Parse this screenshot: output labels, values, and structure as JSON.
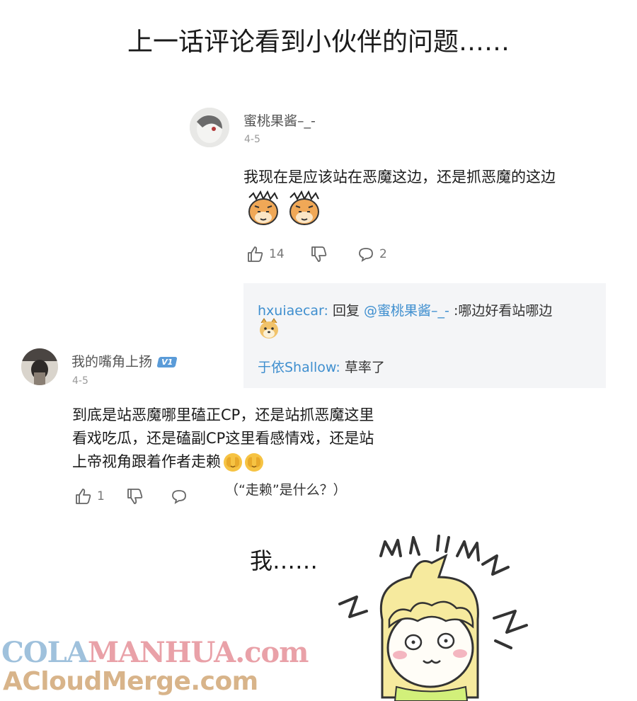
{
  "headline": "上一话评论看到小伙伴的问题……",
  "comment1": {
    "username": "蜜桃果酱–_-",
    "date": "4-5",
    "text": "我现在是应该站在恶魔这边，还是抓恶魔的这边",
    "like_count": "14",
    "reply_count": "2"
  },
  "replies": [
    {
      "user": "hxuiaecar:",
      "prefix": "回复",
      "mention": "@蜜桃果酱–_-",
      "text": ":哪边好看站哪边"
    },
    {
      "user": "于依Shallow:",
      "text": "草率了"
    }
  ],
  "comment2": {
    "username": "我的嘴角上扬",
    "badge": "V1",
    "date": "4-5",
    "lines": [
      "到底是站恶魔哪里磕正CP，还是站抓恶魔这里",
      "看戏吃瓜，还是磕副CP这里看感情戏，还是站",
      "上帝视角跟着作者走赖"
    ],
    "like_count": "1"
  },
  "note": "（“走赖”是什么？）",
  "reaction": "我……",
  "watermark": {
    "line1_a": "COLA",
    "line1_b": "MANHUA",
    "line1_c": ".com",
    "line2": "ACloudMerge.com"
  },
  "icons": [
    "thumbs-up-icon",
    "thumbs-down-icon",
    "comment-icon",
    "tiger-emoji",
    "doge-emoji",
    "covering-face-emoji"
  ],
  "colors": {
    "link_blue": "#3f8fcf",
    "reply_bg": "#f4f5f7",
    "badge_blue": "#5a9bd8"
  }
}
